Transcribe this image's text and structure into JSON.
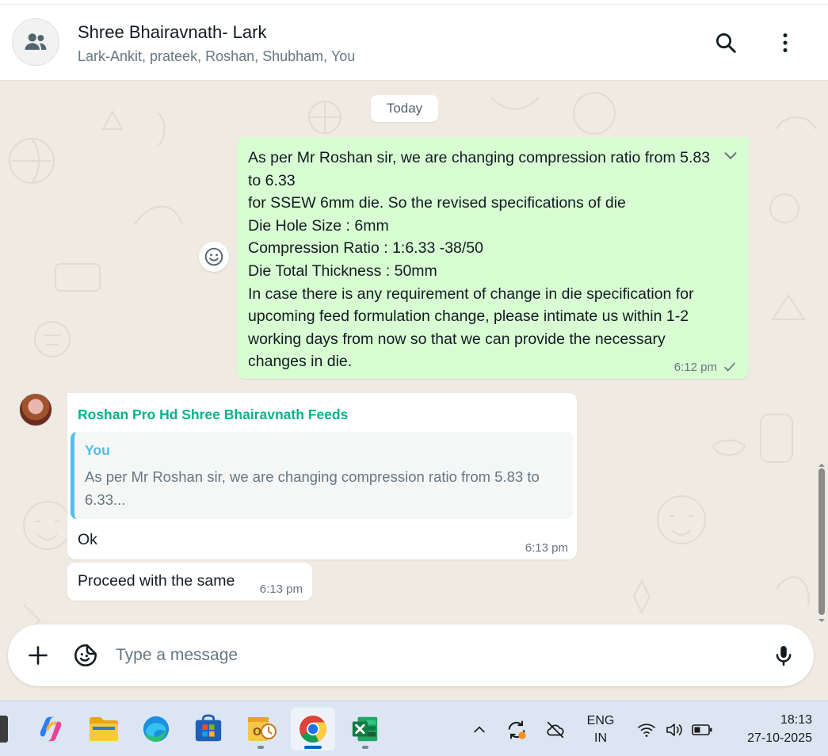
{
  "header": {
    "title": "Shree Bhairavnath- Lark",
    "members": "Lark-Ankit, prateek, Roshan, Shubham, You",
    "icons": {
      "avatar": "group-icon",
      "search": "search-icon",
      "menu": "more-vertical-icon"
    }
  },
  "chat": {
    "date_separator": "Today",
    "messages": [
      {
        "direction": "outgoing",
        "text": "As per Mr Roshan sir, we are changing compression ratio from 5.83 to 6.33\nfor SSEW 6mm die. So the revised specifications of die\nDie Hole Size : 6mm\nCompression Ratio : 1:6.33 -38/50\nDie Total Thickness : 50mm\nIn case there is any requirement of change in die specification for upcoming feed formulation change, please intimate us within 1-2 working days from now so that we can provide the necessary changes in die.",
        "time": "6:12 pm",
        "status": "sent-single-tick"
      },
      {
        "direction": "incoming",
        "sender": "Roshan Pro Hd Shree Bhairavnath Feeds",
        "quote_author": "You",
        "quote_text": "As per Mr Roshan sir, we are changing compression ratio from 5.83 to 6.33...",
        "text": "Ok",
        "time": "6:13 pm"
      },
      {
        "direction": "incoming",
        "text": "Proceed with the same",
        "time": "6:13 pm"
      }
    ]
  },
  "composer": {
    "placeholder": "Type a message",
    "icons": [
      "plus-icon",
      "sticker-icon",
      "microphone-icon"
    ]
  },
  "taskbar": {
    "apps": [
      "copilot",
      "file-explorer",
      "edge",
      "microsoft-store",
      "outlook",
      "chrome",
      "excel"
    ],
    "active_app": "chrome",
    "language_line1": "ENG",
    "language_line2": "IN",
    "time": "18:13",
    "date": "27-10-2025"
  },
  "colors": {
    "outgoing_bubble": "#d9fdd3",
    "sender_name": "#06b38a",
    "quote_accent": "#53bdeb",
    "wallpaper": "#efeae2"
  }
}
